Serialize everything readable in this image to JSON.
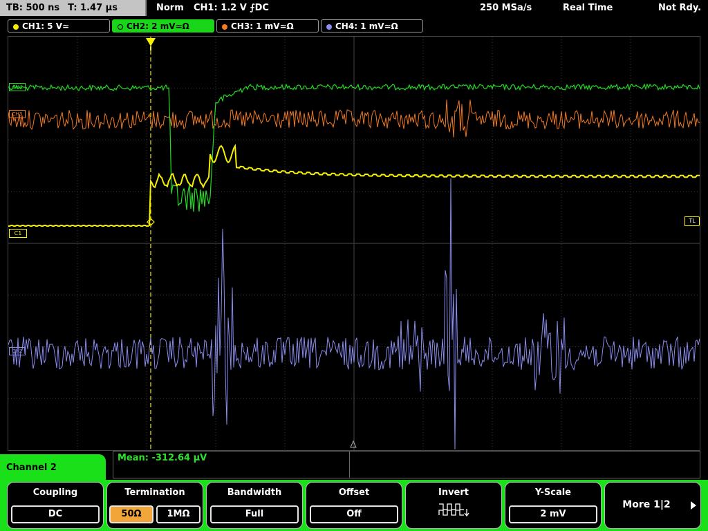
{
  "status": {
    "timebase": "TB: 500 ns",
    "trigger_time": "T: 1.47 µs",
    "mode": "Norm",
    "trigger": "CH1: 1.2 V ⨍DC",
    "sample_rate": "250 MSa/s",
    "acq_mode": "Real Time",
    "state": "Not Rdy."
  },
  "channel_tabs": [
    {
      "label": "CH1: 5 V≃",
      "color": "#f4f000",
      "active": false
    },
    {
      "label": "CH2: 2 mV≃Ω",
      "color": "#22dd22",
      "active": true
    },
    {
      "label": "CH3: 1 mV≃Ω",
      "color": "#f47a1f",
      "active": false
    },
    {
      "label": "CH4: 1 mV≃Ω",
      "color": "#8a8cf0",
      "active": false
    }
  ],
  "markers": {
    "ch4": "CH4",
    "ch3": "CH3",
    "ch1": "C1",
    "ch2_level": "CH2",
    "trigger_level": "TL"
  },
  "measurement": {
    "mean": "Mean: -312.64 µV"
  },
  "menu": {
    "title": "Channel 2",
    "coupling": {
      "title": "Coupling",
      "value": "DC"
    },
    "termination": {
      "title": "Termination",
      "opt1": "50Ω",
      "opt2": "1MΩ",
      "selected": "50Ω"
    },
    "bandwidth": {
      "title": "Bandwidth",
      "value": "Full"
    },
    "offset": {
      "title": "Offset",
      "value": "Off"
    },
    "invert": {
      "title": "Invert"
    },
    "yscale": {
      "title": "Y-Scale",
      "value": "2 mV"
    },
    "more": {
      "label": "More 1|2"
    }
  },
  "colors": {
    "ch1": "#f4f000",
    "ch2": "#22dd22",
    "ch3": "#f47a1f",
    "ch4": "#8a8cf0",
    "active_menu": "#19e019",
    "selected_option": "#f2a63a"
  }
}
